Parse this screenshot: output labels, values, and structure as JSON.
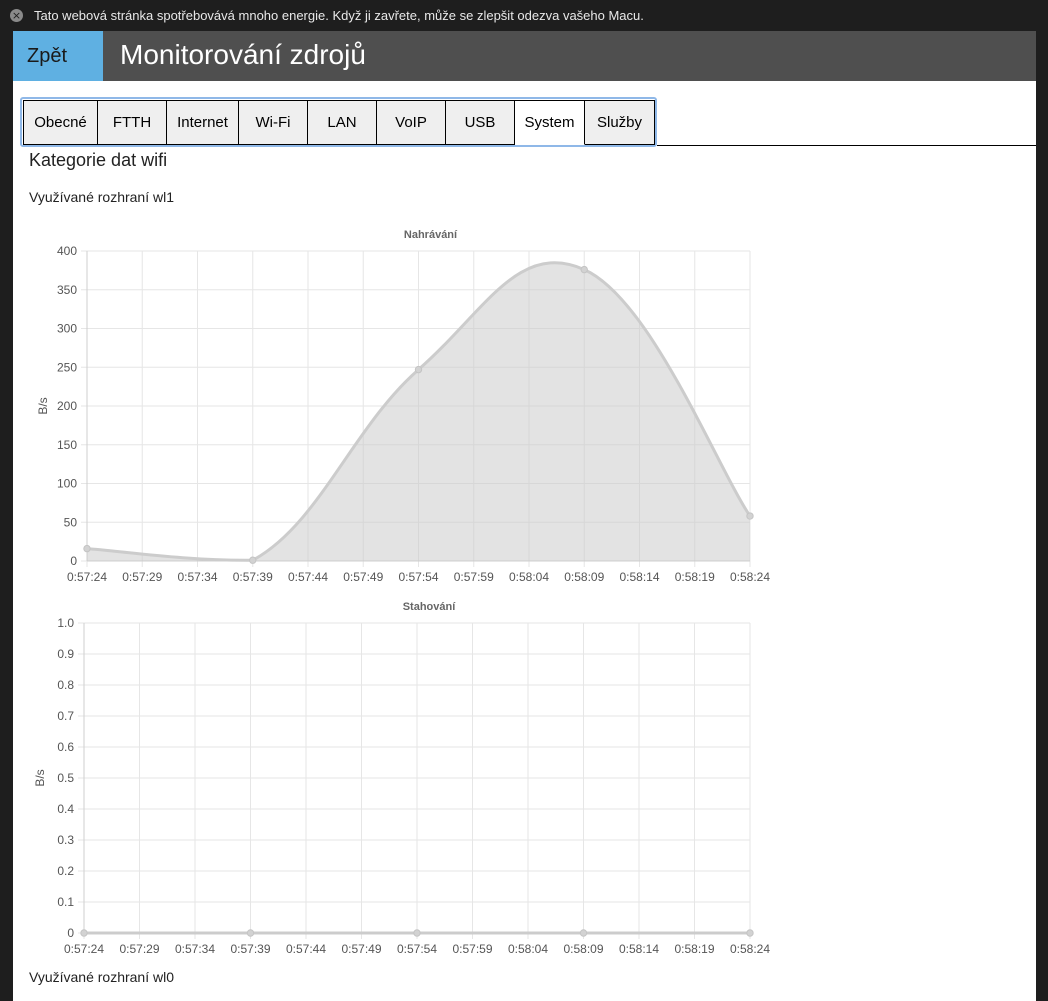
{
  "notification": {
    "icon": "close-circle-icon",
    "text": "Tato webová stránka spotřebovává mnoho energie. Když ji zavřete, může se zlepšit odezva vašeho Macu."
  },
  "header": {
    "back_label": "Zpět",
    "title": "Monitorování zdrojů",
    "back_color": "#5fb0e2",
    "bar_color": "#4f4f4f"
  },
  "tabs": [
    {
      "label": "Obecné"
    },
    {
      "label": "FTTH"
    },
    {
      "label": "Internet"
    },
    {
      "label": "Wi-Fi"
    },
    {
      "label": "LAN"
    },
    {
      "label": "VoIP"
    },
    {
      "label": "USB"
    },
    {
      "label": "System",
      "active": true
    },
    {
      "label": "Služby"
    }
  ],
  "section": {
    "title": "Kategorie dat wifi",
    "interface1": "Využívané rozhraní wl1",
    "interface2": "Využívané rozhraní wl0"
  },
  "chart_data": [
    {
      "type": "area",
      "title": "Nahrávání",
      "ylabel": "B/s",
      "xlabel": "",
      "ylim": [
        0,
        400
      ],
      "yticks": [
        "0",
        "50",
        "100",
        "150",
        "200",
        "250",
        "300",
        "350",
        "400"
      ],
      "xticks": [
        "0:57:24",
        "0:57:29",
        "0:57:34",
        "0:57:39",
        "0:57:44",
        "0:57:49",
        "0:57:54",
        "0:57:59",
        "0:58:04",
        "0:58:09",
        "0:58:14",
        "0:58:19",
        "0:58:24"
      ],
      "points": [
        {
          "x": "0:57:24",
          "y": 16
        },
        {
          "x": "0:57:39",
          "y": 1
        },
        {
          "x": "0:57:54",
          "y": 247
        },
        {
          "x": "0:58:09",
          "y": 376
        },
        {
          "x": "0:58:24",
          "y": 58
        }
      ],
      "grid": true,
      "color": "#cccccc"
    },
    {
      "type": "area",
      "title": "Stahování",
      "ylabel": "B/s",
      "xlabel": "",
      "ylim": [
        0,
        1
      ],
      "yticks": [
        "0",
        "0.1",
        "0.2",
        "0.3",
        "0.4",
        "0.5",
        "0.6",
        "0.7",
        "0.8",
        "0.9",
        "1.0"
      ],
      "xticks": [
        "0:57:24",
        "0:57:29",
        "0:57:34",
        "0:57:39",
        "0:57:44",
        "0:57:49",
        "0:57:54",
        "0:57:59",
        "0:58:04",
        "0:58:09",
        "0:58:14",
        "0:58:19",
        "0:58:24"
      ],
      "points": [
        {
          "x": "0:57:24",
          "y": 0
        },
        {
          "x": "0:57:39",
          "y": 0
        },
        {
          "x": "0:57:54",
          "y": 0
        },
        {
          "x": "0:58:09",
          "y": 0
        },
        {
          "x": "0:58:24",
          "y": 0
        }
      ],
      "grid": true,
      "color": "#cccccc"
    }
  ]
}
